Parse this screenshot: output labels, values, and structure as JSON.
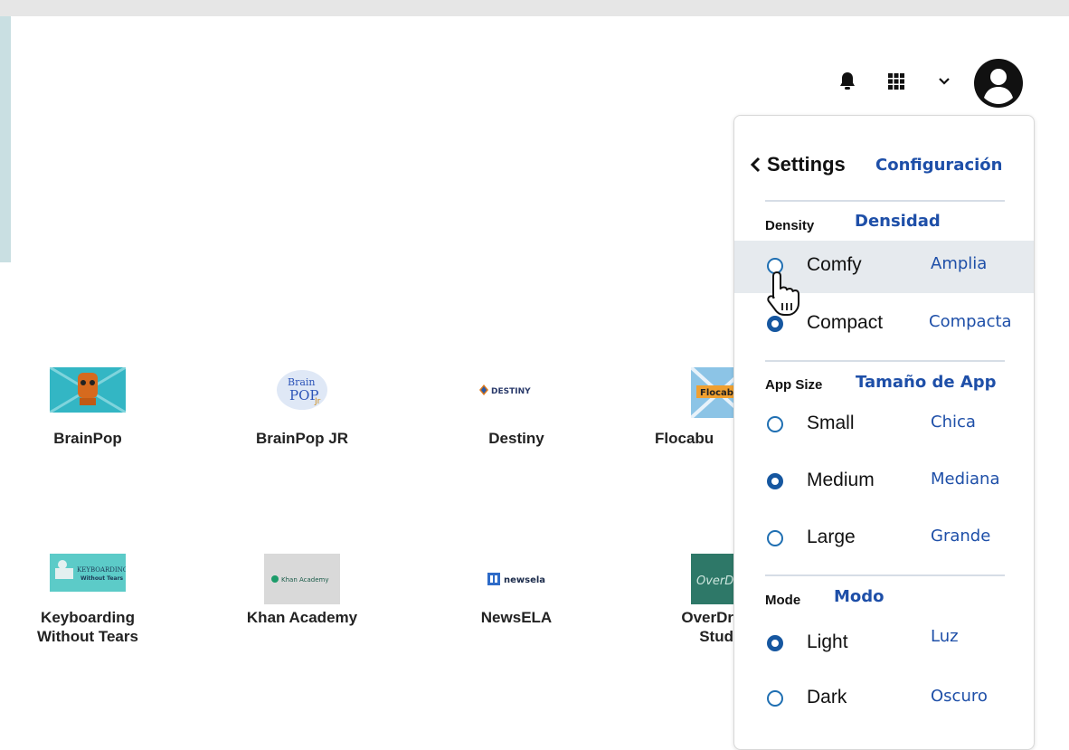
{
  "header": {
    "notifications_icon": "bell-icon",
    "apps_icon": "grid-icon",
    "menu_icon": "chevron-down-icon",
    "account_icon": "user-circle-icon"
  },
  "apps": [
    {
      "name": "BrainPop"
    },
    {
      "name": "BrainPop JR",
      "logo_text": "Brain POP Jr"
    },
    {
      "name": "Destiny",
      "logo_text": "DESTINY"
    },
    {
      "name": "Flocabu",
      "logo_text": "Flocab"
    },
    {
      "name": "Keyboarding Without Tears",
      "logo_text": "KEYBOARDING Without Tears"
    },
    {
      "name": "Khan Academy",
      "logo_text": "Khan Academy"
    },
    {
      "name": "NewsELA",
      "logo_text": "newsela"
    },
    {
      "name": "OverDr Stud",
      "logo_text": "OverD"
    }
  ],
  "settings": {
    "title": "Settings",
    "title_es": "Configuración",
    "density": {
      "label": "Density",
      "label_es": "Densidad",
      "options": [
        {
          "label": "Comfy",
          "es": "Amplia",
          "checked": false
        },
        {
          "label": "Compact",
          "es": "Compacta",
          "checked": true
        }
      ]
    },
    "app_size": {
      "label": "App Size",
      "label_es": "Tamaño de App",
      "options": [
        {
          "label": "Small",
          "es": "Chica",
          "checked": false
        },
        {
          "label": "Medium",
          "es": "Mediana",
          "checked": true
        },
        {
          "label": "Large",
          "es": "Grande",
          "checked": false
        }
      ]
    },
    "mode": {
      "label": "Mode",
      "label_es": "Modo",
      "options": [
        {
          "label": "Light",
          "es": "Luz",
          "checked": true
        },
        {
          "label": "Dark",
          "es": "Oscuro",
          "checked": false
        }
      ]
    }
  },
  "colors": {
    "accent": "#1657a0",
    "translation": "#1e4fa8",
    "hover_row": "#e6eaee"
  }
}
